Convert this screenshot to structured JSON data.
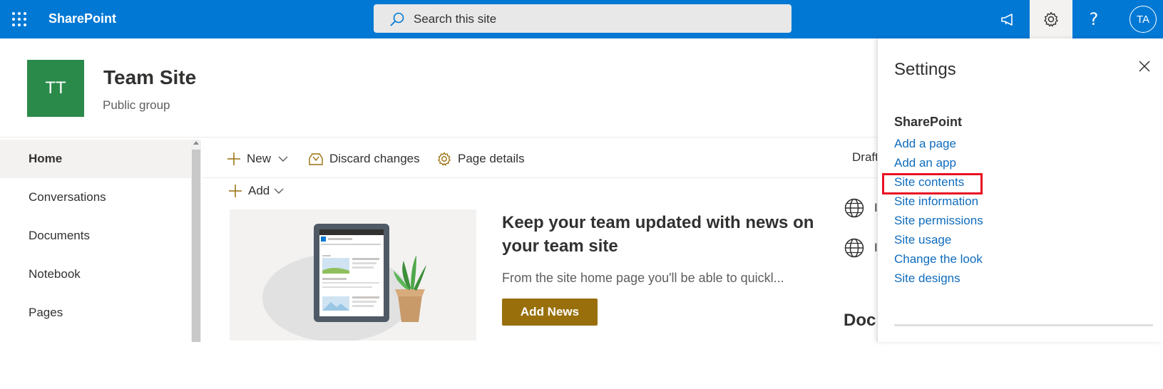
{
  "suitebar": {
    "app_name": "SharePoint",
    "search_placeholder": "Search this site",
    "avatar_initials": "TA",
    "colors": {
      "bar": "#0078d4"
    }
  },
  "site": {
    "logo_initials": "TT",
    "title": "Team Site",
    "subtitle": "Public group",
    "logo_color": "#2a8a4a"
  },
  "leftnav": {
    "items": [
      {
        "label": "Home",
        "selected": true
      },
      {
        "label": "Conversations",
        "selected": false
      },
      {
        "label": "Documents",
        "selected": false
      },
      {
        "label": "Notebook",
        "selected": false
      },
      {
        "label": "Pages",
        "selected": false
      }
    ]
  },
  "commandbar": {
    "new_label": "New",
    "discard_label": "Discard changes",
    "page_details_label": "Page details",
    "status": "Draft"
  },
  "canvas": {
    "add_label": "Add",
    "news": {
      "title": "Keep your team updated with news on your team site",
      "description": "From the site home page you'll be able to quickl...",
      "button_label": "Add News",
      "button_color": "#986f0b"
    },
    "right_column": {
      "globe_letters": [
        "I",
        "I"
      ],
      "heading": "Doc"
    }
  },
  "settings_panel": {
    "title": "Settings",
    "section": "SharePoint",
    "links": [
      "Add a page",
      "Add an app",
      "Site contents",
      "Site information",
      "Site permissions",
      "Site usage",
      "Change the look",
      "Site designs"
    ],
    "highlighted_link": "Site contents",
    "highlight_color": "#e81123"
  }
}
